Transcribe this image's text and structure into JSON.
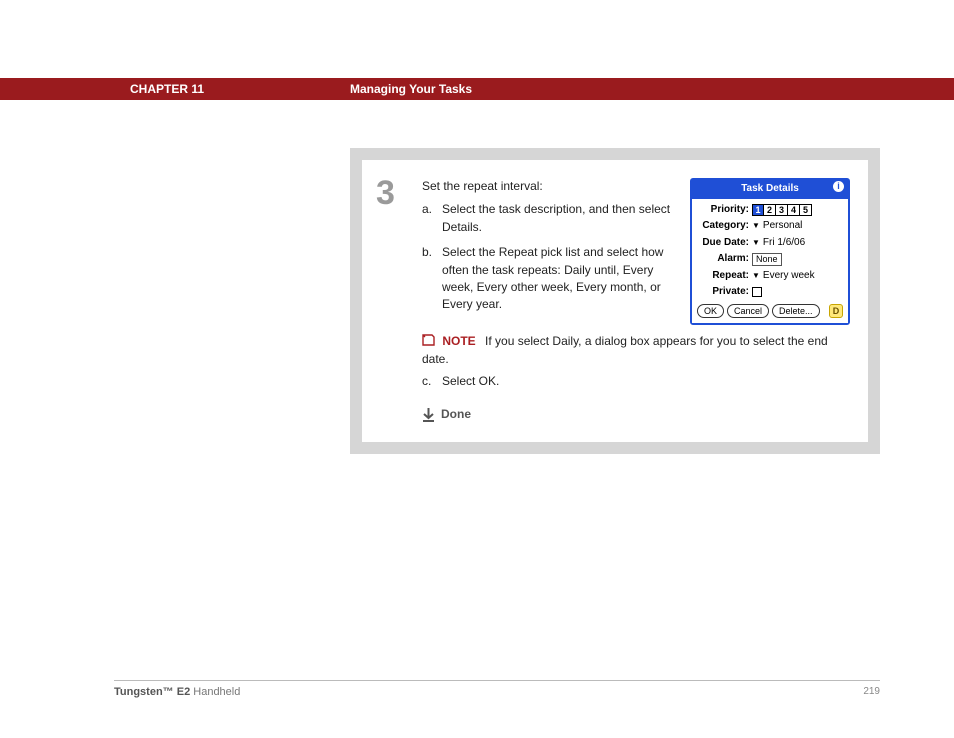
{
  "header": {
    "chapter": "CHAPTER 11",
    "title": "Managing Your Tasks"
  },
  "step": {
    "number": "3",
    "intro": "Set the repeat interval:",
    "items": {
      "a_letter": "a.",
      "a_text": "Select the task description, and then select Details.",
      "b_letter": "b.",
      "b_text": "Select the Repeat pick list and select how often the task repeats: Daily until, Every week, Every other week, Every month, or Every year.",
      "c_letter": "c.",
      "c_text": "Select OK."
    },
    "note_label": "NOTE",
    "note_text": "If you select Daily, a dialog box appears for you to select the end date.",
    "done": "Done"
  },
  "task": {
    "title": "Task Details",
    "info": "i",
    "priority_label": "Priority:",
    "priority_values": {
      "p1": "1",
      "p2": "2",
      "p3": "3",
      "p4": "4",
      "p5": "5"
    },
    "category_label": "Category:",
    "category_value": "Personal",
    "due_label": "Due Date:",
    "due_value": "Fri 1/6/06",
    "alarm_label": "Alarm:",
    "alarm_value": "None",
    "repeat_label": "Repeat:",
    "repeat_value": "Every week",
    "private_label": "Private:",
    "buttons": {
      "ok": "OK",
      "cancel": "Cancel",
      "delete": "Delete...",
      "tip": "D"
    }
  },
  "footer": {
    "product_bold": "Tungsten™ E2",
    "product_rest": " Handheld",
    "page": "219"
  }
}
